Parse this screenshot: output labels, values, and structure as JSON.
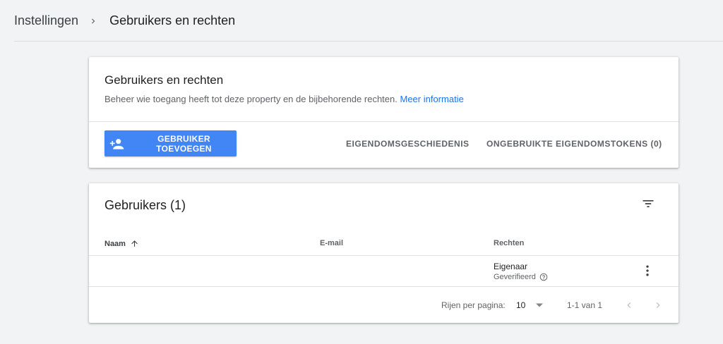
{
  "breadcrumb": {
    "root": "Instellingen",
    "current": "Gebruikers en rechten"
  },
  "header_card": {
    "title": "Gebruikers en rechten",
    "description": "Beheer wie toegang heeft tot deze property en de bijbehorende rechten.",
    "link": "Meer informatie",
    "add_user_label": "GEBRUIKER TOEVOEGEN",
    "history_label": "EIGENDOMSGESCHIEDENIS",
    "tokens_label": "ONGEBRUIKTE EIGENDOMSTOKENS (0)"
  },
  "users_card": {
    "title": "Gebruikers (1)",
    "columns": {
      "name": "Naam",
      "email": "E-mail",
      "rights": "Rechten"
    },
    "rows": [
      {
        "name": "",
        "email": "",
        "role": "Eigenaar",
        "status": "Geverifieerd"
      }
    ],
    "pagination": {
      "rows_per_page_label": "Rijen per pagina:",
      "rows_per_page": "10",
      "range": "1-1 van 1"
    }
  },
  "colors": {
    "primary": "#4285f4",
    "link": "#1a73e8",
    "background": "#f1f3f4"
  },
  "icons": {
    "separator": "chevron-right-icon",
    "add_user": "person-add-icon",
    "filter": "filter-icon",
    "sort": "arrow-up-icon",
    "help": "help-circle-icon",
    "more": "more-vert-icon",
    "dropdown": "arrow-drop-down-icon",
    "prev": "chevron-left-icon",
    "next": "chevron-right-icon"
  }
}
